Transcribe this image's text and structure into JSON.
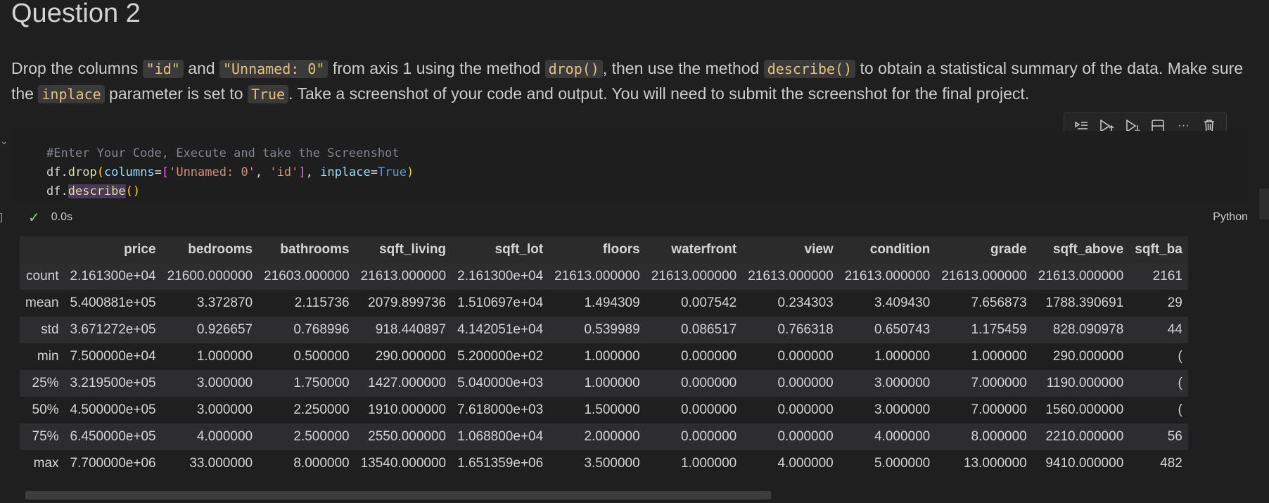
{
  "heading": "Question 2",
  "instruction": {
    "t1": "Drop the columns ",
    "c1": "\"id\"",
    "t2": " and ",
    "c2": "\"Unnamed: 0\"",
    "t3": " from axis 1 using the method ",
    "c3": "drop()",
    "t4": ", then use the method ",
    "c4": "describe()",
    "t5": " to obtain a statistical summary of the data. Make sure the ",
    "c5": "inplace",
    "t6": " parameter is set to ",
    "c6": "True",
    "t7": ". Take a screenshot of your code and output. You will need to submit the screenshot for the final project."
  },
  "toolbar": {
    "icons": [
      "run-by-line-icon",
      "execute-above-icon",
      "execute-below-icon",
      "split-cell-icon",
      "more-icon",
      "delete-icon"
    ],
    "more_glyph": "···"
  },
  "code": {
    "comment": "#Enter Your Code, Execute and take the Screenshot",
    "l2": {
      "obj": "df",
      "dot": ".",
      "fn": "drop",
      "open": "(",
      "param1": "columns",
      "eq": "=",
      "lbr": "[",
      "s1": "'Unnamed: 0'",
      "comma": ", ",
      "s2": "'id'",
      "rbr": "]",
      "comma2": ", ",
      "param2": "inplace",
      "eq2": "=",
      "val": "True",
      "close": ")"
    },
    "l3": {
      "obj": "df",
      "dot": ".",
      "fn": "describe",
      "parens": "()"
    }
  },
  "status": {
    "check": "✓",
    "time": "0.0s",
    "language": "Python",
    "bracket": "]"
  },
  "table": {
    "columns": [
      "",
      "price",
      "bedrooms",
      "bathrooms",
      "sqft_living",
      "sqft_lot",
      "floors",
      "waterfront",
      "view",
      "condition",
      "grade",
      "sqft_above",
      "sqft_ba"
    ],
    "rows": [
      [
        "count",
        "2.161300e+04",
        "21600.000000",
        "21603.000000",
        "21613.000000",
        "2.161300e+04",
        "21613.000000",
        "21613.000000",
        "21613.000000",
        "21613.000000",
        "21613.000000",
        "21613.000000",
        "2161"
      ],
      [
        "mean",
        "5.400881e+05",
        "3.372870",
        "2.115736",
        "2079.899736",
        "1.510697e+04",
        "1.494309",
        "0.007542",
        "0.234303",
        "3.409430",
        "7.656873",
        "1788.390691",
        "29"
      ],
      [
        "std",
        "3.671272e+05",
        "0.926657",
        "0.768996",
        "918.440897",
        "4.142051e+04",
        "0.539989",
        "0.086517",
        "0.766318",
        "0.650743",
        "1.175459",
        "828.090978",
        "44"
      ],
      [
        "min",
        "7.500000e+04",
        "1.000000",
        "0.500000",
        "290.000000",
        "5.200000e+02",
        "1.000000",
        "0.000000",
        "0.000000",
        "1.000000",
        "1.000000",
        "290.000000",
        "("
      ],
      [
        "25%",
        "3.219500e+05",
        "3.000000",
        "1.750000",
        "1427.000000",
        "5.040000e+03",
        "1.000000",
        "0.000000",
        "0.000000",
        "3.000000",
        "7.000000",
        "1190.000000",
        "("
      ],
      [
        "50%",
        "4.500000e+05",
        "3.000000",
        "2.250000",
        "1910.000000",
        "7.618000e+03",
        "1.500000",
        "0.000000",
        "0.000000",
        "3.000000",
        "7.000000",
        "1560.000000",
        "("
      ],
      [
        "75%",
        "6.450000e+05",
        "4.000000",
        "2.500000",
        "2550.000000",
        "1.068800e+04",
        "2.000000",
        "0.000000",
        "0.000000",
        "4.000000",
        "8.000000",
        "2210.000000",
        "56"
      ],
      [
        "max",
        "7.700000e+06",
        "33.000000",
        "8.000000",
        "13540.000000",
        "1.651359e+06",
        "3.500000",
        "1.000000",
        "4.000000",
        "5.000000",
        "13.000000",
        "9410.000000",
        "482"
      ]
    ]
  }
}
